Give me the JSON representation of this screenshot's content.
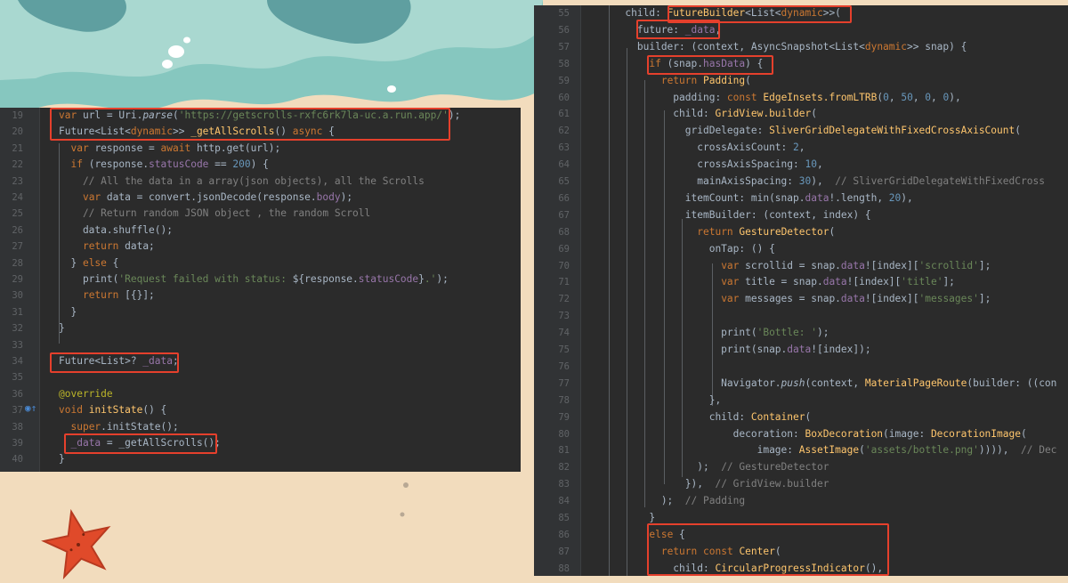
{
  "left_editor": {
    "lines": [
      {
        "n": "19",
        "segs": [
          {
            "t": "var",
            "c": "kw"
          },
          {
            "t": " url = Uri."
          },
          {
            "t": "parse",
            "c": "it"
          },
          {
            "t": "("
          },
          {
            "t": "'https://getscrolls-rxfc6rk7la-uc.a.run.app/'",
            "c": "str"
          },
          {
            "t": ");"
          }
        ]
      },
      {
        "n": "20",
        "segs": [
          {
            "t": "Future<List<"
          },
          {
            "t": "dynamic",
            "c": "kw"
          },
          {
            "t": ">> "
          },
          {
            "t": "_getAllScrolls",
            "c": "fn"
          },
          {
            "t": "() "
          },
          {
            "t": "async",
            "c": "kw"
          },
          {
            "t": " {"
          }
        ]
      },
      {
        "n": "21",
        "segs": [
          {
            "t": "  "
          },
          {
            "t": "var",
            "c": "kw"
          },
          {
            "t": " response = "
          },
          {
            "t": "await",
            "c": "kw"
          },
          {
            "t": " http.get(url);"
          }
        ]
      },
      {
        "n": "22",
        "segs": [
          {
            "t": "  "
          },
          {
            "t": "if",
            "c": "kw"
          },
          {
            "t": " (response."
          },
          {
            "t": "statusCode",
            "c": "fld"
          },
          {
            "t": " == "
          },
          {
            "t": "200",
            "c": "num"
          },
          {
            "t": ") {"
          }
        ]
      },
      {
        "n": "23",
        "segs": [
          {
            "t": "    // All the data in a array(json objects), all the Scrolls",
            "c": "cm"
          }
        ]
      },
      {
        "n": "24",
        "segs": [
          {
            "t": "    "
          },
          {
            "t": "var",
            "c": "kw"
          },
          {
            "t": " data = convert.jsonDecode(response."
          },
          {
            "t": "body",
            "c": "fld"
          },
          {
            "t": ");"
          }
        ]
      },
      {
        "n": "25",
        "segs": [
          {
            "t": "    // Return random JSON object , the random Scroll",
            "c": "cm"
          }
        ]
      },
      {
        "n": "26",
        "segs": [
          {
            "t": "    data.shuffle();"
          }
        ]
      },
      {
        "n": "27",
        "segs": [
          {
            "t": "    "
          },
          {
            "t": "return",
            "c": "kw"
          },
          {
            "t": " data;"
          }
        ]
      },
      {
        "n": "28",
        "segs": [
          {
            "t": "  } "
          },
          {
            "t": "else",
            "c": "kw"
          },
          {
            "t": " {"
          }
        ]
      },
      {
        "n": "29",
        "segs": [
          {
            "t": "    print("
          },
          {
            "t": "'Request failed with status: ",
            "c": "str"
          },
          {
            "t": "${response."
          },
          {
            "t": "statusCode",
            "c": "fld"
          },
          {
            "t": "}"
          },
          {
            "t": ".'",
            "c": "str"
          },
          {
            "t": ");"
          }
        ]
      },
      {
        "n": "30",
        "segs": [
          {
            "t": "    "
          },
          {
            "t": "return",
            "c": "kw"
          },
          {
            "t": " [{}];"
          }
        ]
      },
      {
        "n": "31",
        "segs": [
          {
            "t": "  }"
          }
        ]
      },
      {
        "n": "32",
        "segs": [
          {
            "t": "}"
          }
        ]
      },
      {
        "n": "33",
        "segs": []
      },
      {
        "n": "34",
        "segs": [
          {
            "t": "Future<List>? "
          },
          {
            "t": "_data",
            "c": "fld"
          },
          {
            "t": ";"
          }
        ]
      },
      {
        "n": "35",
        "segs": []
      },
      {
        "n": "36",
        "segs": [
          {
            "t": "@override",
            "c": "ann"
          }
        ]
      },
      {
        "n": "37",
        "segs": [
          {
            "t": "void",
            "c": "kw"
          },
          {
            "t": " "
          },
          {
            "t": "initState",
            "c": "fn"
          },
          {
            "t": "() {"
          }
        ]
      },
      {
        "n": "38",
        "segs": [
          {
            "t": "  "
          },
          {
            "t": "super",
            "c": "kw"
          },
          {
            "t": ".initState();"
          }
        ]
      },
      {
        "n": "39",
        "segs": [
          {
            "t": "  "
          },
          {
            "t": "_data",
            "c": "fld"
          },
          {
            "t": " = _getAllScrolls();"
          }
        ]
      },
      {
        "n": "40",
        "segs": [
          {
            "t": "}"
          }
        ]
      }
    ]
  },
  "right_editor": {
    "lines": [
      {
        "n": "55",
        "segs": [
          {
            "t": "      child: "
          },
          {
            "t": "FutureBuilder",
            "c": "fn"
          },
          {
            "t": "<List<"
          },
          {
            "t": "dynamic",
            "c": "kw"
          },
          {
            "t": ">>("
          }
        ]
      },
      {
        "n": "56",
        "segs": [
          {
            "t": "        future: "
          },
          {
            "t": "_data",
            "c": "fld"
          },
          {
            "t": ","
          }
        ]
      },
      {
        "n": "57",
        "segs": [
          {
            "t": "        builder: (context, AsyncSnapshot<List<"
          },
          {
            "t": "dynamic",
            "c": "kw"
          },
          {
            "t": ">> snap) {"
          }
        ]
      },
      {
        "n": "58",
        "segs": [
          {
            "t": "          "
          },
          {
            "t": "if",
            "c": "kw"
          },
          {
            "t": " (snap."
          },
          {
            "t": "hasData",
            "c": "fld"
          },
          {
            "t": ") {"
          }
        ]
      },
      {
        "n": "59",
        "segs": [
          {
            "t": "            "
          },
          {
            "t": "return",
            "c": "kw"
          },
          {
            "t": " "
          },
          {
            "t": "Padding",
            "c": "fn"
          },
          {
            "t": "("
          }
        ]
      },
      {
        "n": "60",
        "segs": [
          {
            "t": "              padding: "
          },
          {
            "t": "const",
            "c": "kw"
          },
          {
            "t": " "
          },
          {
            "t": "EdgeInsets.fromLTRB",
            "c": "fn"
          },
          {
            "t": "("
          },
          {
            "t": "0",
            "c": "num"
          },
          {
            "t": ", "
          },
          {
            "t": "50",
            "c": "num"
          },
          {
            "t": ", "
          },
          {
            "t": "0",
            "c": "num"
          },
          {
            "t": ", "
          },
          {
            "t": "0",
            "c": "num"
          },
          {
            "t": "),"
          }
        ]
      },
      {
        "n": "61",
        "segs": [
          {
            "t": "              child: "
          },
          {
            "t": "GridView.builder",
            "c": "fn"
          },
          {
            "t": "("
          }
        ]
      },
      {
        "n": "62",
        "segs": [
          {
            "t": "                gridDelegate: "
          },
          {
            "t": "SliverGridDelegateWithFixedCrossAxisCount",
            "c": "fn"
          },
          {
            "t": "("
          }
        ]
      },
      {
        "n": "63",
        "segs": [
          {
            "t": "                  crossAxisCount: "
          },
          {
            "t": "2",
            "c": "num"
          },
          {
            "t": ","
          }
        ]
      },
      {
        "n": "64",
        "segs": [
          {
            "t": "                  crossAxisSpacing: "
          },
          {
            "t": "10",
            "c": "num"
          },
          {
            "t": ","
          }
        ]
      },
      {
        "n": "65",
        "segs": [
          {
            "t": "                  mainAxisSpacing: "
          },
          {
            "t": "30",
            "c": "num"
          },
          {
            "t": "),  "
          },
          {
            "t": "// SliverGridDelegateWithFixedCross",
            "c": "cm"
          }
        ]
      },
      {
        "n": "66",
        "segs": [
          {
            "t": "                itemCount: min(snap."
          },
          {
            "t": "data",
            "c": "fld"
          },
          {
            "t": "!.length, "
          },
          {
            "t": "20",
            "c": "num"
          },
          {
            "t": "),"
          }
        ]
      },
      {
        "n": "67",
        "segs": [
          {
            "t": "                itemBuilder: (context, index) {"
          }
        ]
      },
      {
        "n": "68",
        "segs": [
          {
            "t": "                  "
          },
          {
            "t": "return",
            "c": "kw"
          },
          {
            "t": " "
          },
          {
            "t": "GestureDetector",
            "c": "fn"
          },
          {
            "t": "("
          }
        ]
      },
      {
        "n": "69",
        "segs": [
          {
            "t": "                    onTap: () {"
          }
        ]
      },
      {
        "n": "70",
        "segs": [
          {
            "t": "                      "
          },
          {
            "t": "var",
            "c": "kw"
          },
          {
            "t": " scrollid = snap."
          },
          {
            "t": "data",
            "c": "fld"
          },
          {
            "t": "![index]["
          },
          {
            "t": "'scrollid'",
            "c": "str"
          },
          {
            "t": "];"
          }
        ]
      },
      {
        "n": "71",
        "segs": [
          {
            "t": "                      "
          },
          {
            "t": "var",
            "c": "kw"
          },
          {
            "t": " title = snap."
          },
          {
            "t": "data",
            "c": "fld"
          },
          {
            "t": "![index]["
          },
          {
            "t": "'title'",
            "c": "str"
          },
          {
            "t": "];"
          }
        ]
      },
      {
        "n": "72",
        "segs": [
          {
            "t": "                      "
          },
          {
            "t": "var",
            "c": "kw"
          },
          {
            "t": " messages = snap."
          },
          {
            "t": "data",
            "c": "fld"
          },
          {
            "t": "![index]["
          },
          {
            "t": "'messages'",
            "c": "str"
          },
          {
            "t": "];"
          }
        ]
      },
      {
        "n": "73",
        "segs": []
      },
      {
        "n": "74",
        "segs": [
          {
            "t": "                      print("
          },
          {
            "t": "'Bottle: '",
            "c": "str"
          },
          {
            "t": ");"
          }
        ]
      },
      {
        "n": "75",
        "segs": [
          {
            "t": "                      print(snap."
          },
          {
            "t": "data",
            "c": "fld"
          },
          {
            "t": "![index]);"
          }
        ]
      },
      {
        "n": "76",
        "segs": []
      },
      {
        "n": "77",
        "segs": [
          {
            "t": "                      Navigator."
          },
          {
            "t": "push",
            "c": "it"
          },
          {
            "t": "(context, "
          },
          {
            "t": "MaterialPageRoute",
            "c": "fn"
          },
          {
            "t": "(builder: ((con"
          }
        ]
      },
      {
        "n": "78",
        "segs": [
          {
            "t": "                    },"
          }
        ]
      },
      {
        "n": "79",
        "segs": [
          {
            "t": "                    child: "
          },
          {
            "t": "Container",
            "c": "fn"
          },
          {
            "t": "("
          }
        ]
      },
      {
        "n": "80",
        "segs": [
          {
            "t": "                        decoration: "
          },
          {
            "t": "BoxDecoration",
            "c": "fn"
          },
          {
            "t": "(image: "
          },
          {
            "t": "DecorationImage",
            "c": "fn"
          },
          {
            "t": "("
          }
        ]
      },
      {
        "n": "81",
        "segs": [
          {
            "t": "                            image: "
          },
          {
            "t": "AssetImage",
            "c": "fn"
          },
          {
            "t": "("
          },
          {
            "t": "'assets/bottle.png'",
            "c": "str"
          },
          {
            "t": ")))),  "
          },
          {
            "t": "// Dec",
            "c": "cm"
          }
        ]
      },
      {
        "n": "82",
        "segs": [
          {
            "t": "                  );  "
          },
          {
            "t": "// GestureDetector",
            "c": "cm"
          }
        ]
      },
      {
        "n": "83",
        "segs": [
          {
            "t": "                }),  "
          },
          {
            "t": "// GridView.builder",
            "c": "cm"
          }
        ]
      },
      {
        "n": "84",
        "segs": [
          {
            "t": "            );  "
          },
          {
            "t": "// Padding",
            "c": "cm"
          }
        ]
      },
      {
        "n": "85",
        "segs": [
          {
            "t": "          }"
          }
        ]
      },
      {
        "n": "86",
        "segs": [
          {
            "t": "          "
          },
          {
            "t": "else",
            "c": "kw"
          },
          {
            "t": " {"
          }
        ]
      },
      {
        "n": "87",
        "segs": [
          {
            "t": "            "
          },
          {
            "t": "return",
            "c": "kw"
          },
          {
            "t": " "
          },
          {
            "t": "const",
            "c": "kw"
          },
          {
            "t": " "
          },
          {
            "t": "Center",
            "c": "fn"
          },
          {
            "t": "("
          }
        ]
      },
      {
        "n": "88",
        "segs": [
          {
            "t": "              child: "
          },
          {
            "t": "CircularProgressIndicator",
            "c": "fn"
          },
          {
            "t": "(),"
          }
        ]
      }
    ]
  }
}
